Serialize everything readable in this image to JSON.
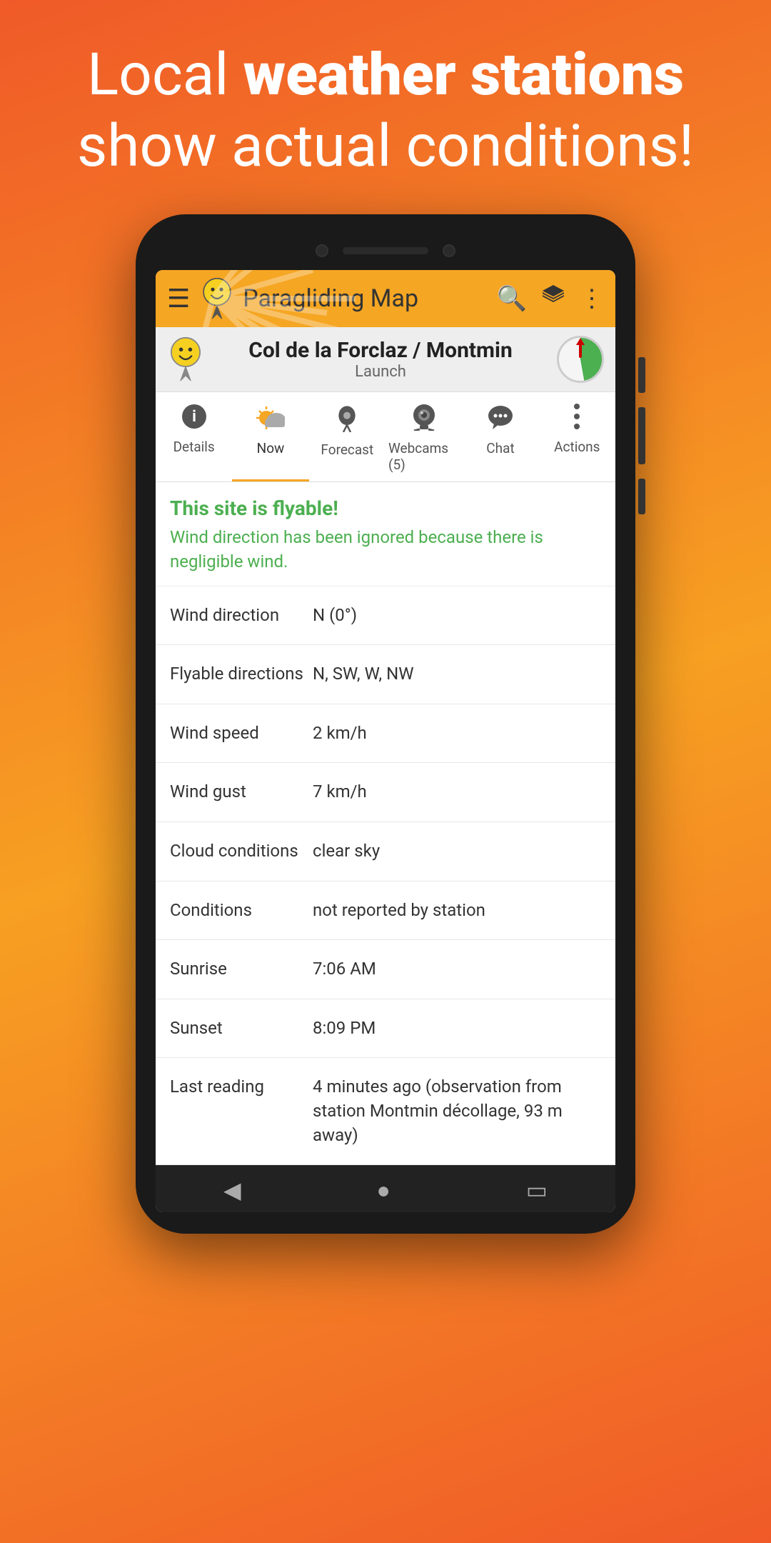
{
  "promo": {
    "line1_normal": "Local ",
    "line1_bold": "weather stations",
    "line2": "show actual conditions!"
  },
  "app": {
    "title": "Paragliding Map",
    "location_name": "Col de la Forclaz / Montmin",
    "location_type": "Launch"
  },
  "tabs": [
    {
      "id": "details",
      "label": "Details",
      "icon": "ℹ",
      "active": false
    },
    {
      "id": "now",
      "label": "Now",
      "icon": "⛅",
      "active": true
    },
    {
      "id": "forecast",
      "label": "Forecast",
      "icon": "📍",
      "active": false
    },
    {
      "id": "webcams",
      "label": "Webcams (5)",
      "icon": "📷",
      "active": false
    },
    {
      "id": "chat",
      "label": "Chat",
      "icon": "💬",
      "active": false
    },
    {
      "id": "actions",
      "label": "Actions",
      "icon": "⋮",
      "active": false
    }
  ],
  "flyable": {
    "title": "This site is flyable!",
    "description": "Wind direction has been ignored because there is negligible wind."
  },
  "data_rows": [
    {
      "label": "Wind direction",
      "value": "N (0°)"
    },
    {
      "label": "Flyable directions",
      "value": "N, SW, W, NW"
    },
    {
      "label": "Wind speed",
      "value": "2 km/h"
    },
    {
      "label": "Wind gust",
      "value": "7 km/h"
    },
    {
      "label": "Cloud conditions",
      "value": "clear sky"
    },
    {
      "label": "Conditions",
      "value": "not reported by station"
    },
    {
      "label": "Sunrise",
      "value": "7:06 AM"
    },
    {
      "label": "Sunset",
      "value": "8:09 PM"
    },
    {
      "label": "Last reading",
      "value": "4 minutes ago (observation from station Montmin décollage, 93 m away)"
    }
  ],
  "toolbar_icons": {
    "menu": "☰",
    "search": "🔍",
    "layers": "⬛",
    "more": "⋮"
  },
  "bottom_nav": [
    {
      "icon": "◀",
      "label": "back"
    },
    {
      "icon": "⬤",
      "label": "home"
    },
    {
      "icon": "▮▮",
      "label": "recents"
    }
  ]
}
